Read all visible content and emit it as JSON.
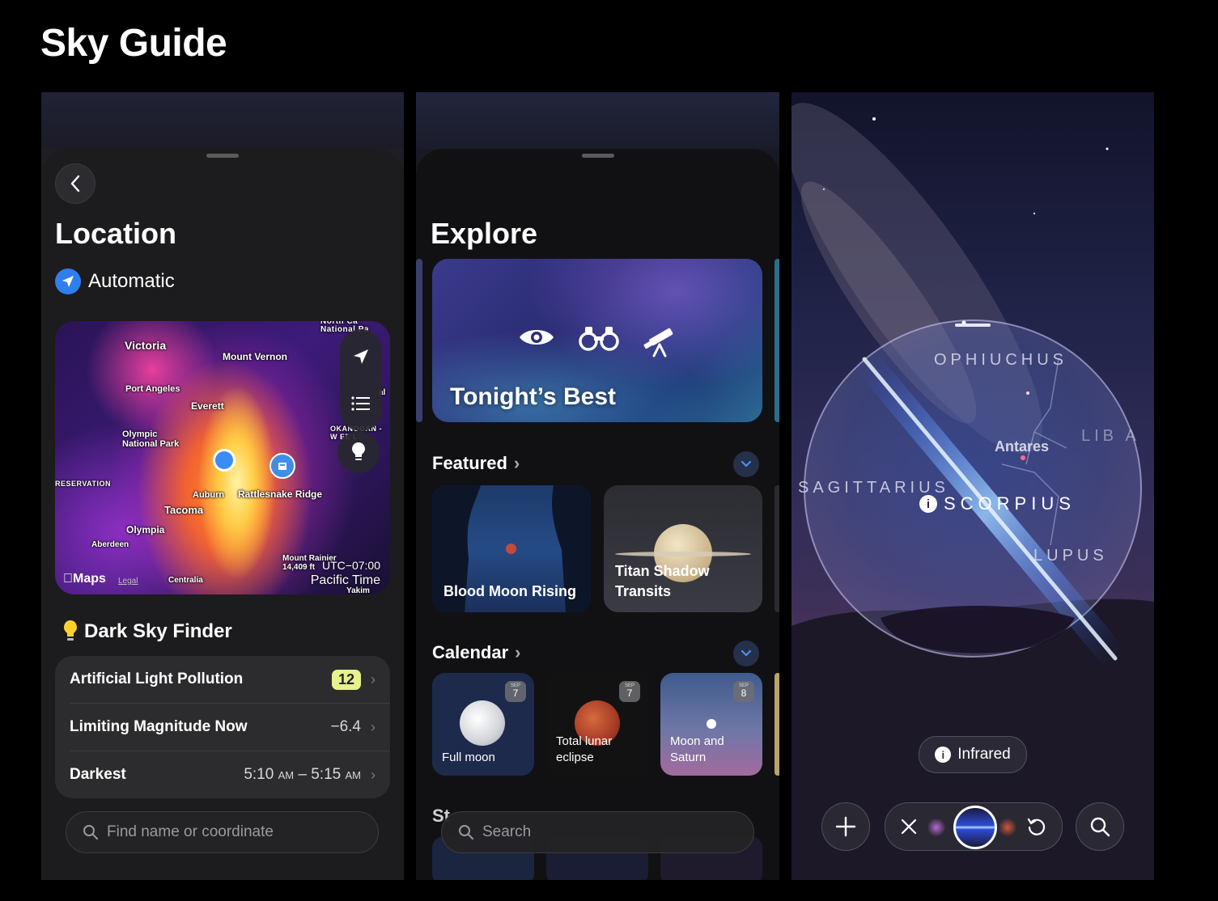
{
  "page_title": "Sky Guide",
  "location": {
    "title": "Location",
    "mode": "Automatic",
    "map": {
      "places": {
        "victoria": "Victoria",
        "mount_vernon": "Mount Vernon",
        "north_park": "North Ca National Pa",
        "port_angeles": "Port Angeles",
        "everett": "Everett",
        "olympic": "Olympic National Park",
        "okanogan": "OKANOGAN - W    EE L",
        "reservation": "RESERVATION",
        "auburn": "Auburn",
        "rattlesnake": "Rattlesnake Ridge",
        "tacoma": "Tacoma",
        "olympia": "Olympia",
        "aberdeen": "Aberdeen",
        "mount_rainier": "Mount Rainier 14,409 ft",
        "centralia": "Centralia",
        "yakima": "Yakim",
        "edge_al": "al"
      },
      "maps_logo": "Maps",
      "legal": "Legal",
      "timezone_offset": "UTC−07:00",
      "timezone_name": "Pacific Time"
    },
    "dark_sky": {
      "title": "Dark Sky Finder",
      "rows": [
        {
          "label": "Artificial Light Pollution",
          "value": "12"
        },
        {
          "label": "Limiting Magnitude Now",
          "value": "−6.4"
        },
        {
          "label": "Darkest",
          "start": "5:10",
          "end": "5:15",
          "suffix": "AM",
          "dash": "–"
        }
      ]
    },
    "search_placeholder": "Find name or coordinate"
  },
  "explore": {
    "title": "Explore",
    "hero": "Tonight’s Best",
    "featured": {
      "title": "Featured",
      "items": [
        "Blood Moon Rising",
        "Titan Shadow Transits"
      ]
    },
    "calendar": {
      "title": "Calendar",
      "items": [
        {
          "label": "Full moon",
          "month": "SEP",
          "day": "7"
        },
        {
          "label": "Total lunar eclipse",
          "month": "SEP",
          "day": "7"
        },
        {
          "label": "Moon and Saturn",
          "month": "SEP",
          "day": "8"
        }
      ]
    },
    "next_section_partial": "St",
    "search_placeholder": "Search"
  },
  "sky": {
    "constellations": {
      "ophiuchus": "OPHIUCHUS",
      "libra": "LIB  A",
      "sagittarius": "SAGITTARIUS",
      "scorpius": "SCORPIUS",
      "lupus": "LUPUS"
    },
    "star": "Antares",
    "filter_chip": "Infrared"
  },
  "colors": {
    "accent_blue": "#2f7ef0",
    "badge_yellow": "#e7f28c",
    "background": "#000000"
  }
}
